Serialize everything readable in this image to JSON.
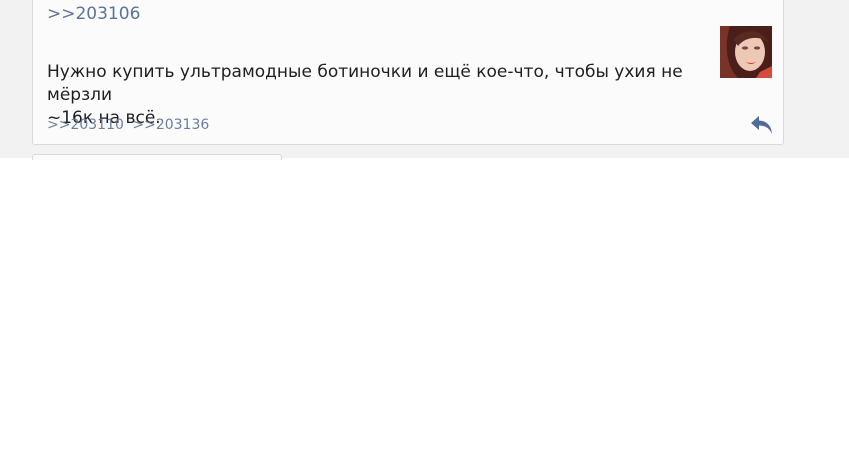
{
  "post": {
    "quote_link": ">>203106",
    "text_line1": "Нужно купить ультрамодные ботиночки и ещё кое-что, чтобы ухия не мёрзли",
    "text_line2": "~16к на всё.",
    "replies": [
      ">>203110",
      ">>203136"
    ],
    "thumbnail_icon": "avatar-photo-icon",
    "reply_icon": "reply-arrow-icon"
  },
  "colors": {
    "link": "#5a7499",
    "background": "#f2f2f2",
    "post_bg": "#fbfbfb",
    "icon": "#4f6d96"
  }
}
